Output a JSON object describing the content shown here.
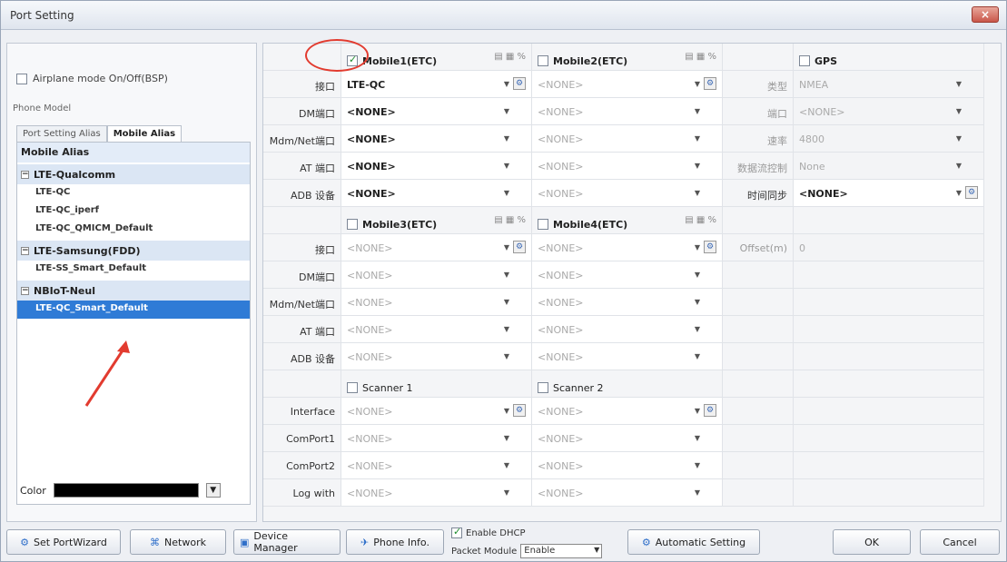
{
  "window": {
    "title": "Port Setting",
    "close_label": "×"
  },
  "left": {
    "airplane_label": "Airplane mode On/Off(BSP)",
    "group_label": "Phone Model",
    "tabs": [
      "Port Setting Alias",
      "Mobile Alias"
    ],
    "list_header": "Mobile Alias",
    "groups": [
      {
        "name": "LTE-Qualcomm",
        "items": [
          "LTE-QC",
          "LTE-QC_iperf",
          "LTE-QC_QMICM_Default"
        ]
      },
      {
        "name": "LTE-Samsung(FDD)",
        "items": [
          "LTE-SS_Smart_Default"
        ]
      },
      {
        "name": "NBIoT-Neul",
        "items": [
          "LTE-QC_Smart_Default"
        ]
      }
    ],
    "color_label": "Color"
  },
  "grid": {
    "mobile1": {
      "name": "Mobile1(ETC)",
      "checked": true
    },
    "mobile2": {
      "name": "Mobile2(ETC)",
      "checked": false
    },
    "mobile3": {
      "name": "Mobile3(ETC)",
      "checked": false
    },
    "mobile4": {
      "name": "Mobile4(ETC)",
      "checked": false
    },
    "gps": {
      "name": "GPS",
      "checked": false
    },
    "scanner1": "Scanner 1",
    "scanner2": "Scanner 2",
    "port_labels": [
      "接口",
      "DM端口",
      "Mdm/Net端口",
      "AT 端口",
      "ADB 设备"
    ],
    "scanner_labels": [
      "Interface",
      "ComPort1",
      "ComPort2",
      "Log with"
    ],
    "m1_values": [
      "LTE-QC",
      "<NONE>",
      "<NONE>",
      "<NONE>",
      "<NONE>"
    ],
    "none": "<NONE>",
    "gps_labels": [
      "类型",
      "端口",
      "速率",
      "数据流控制"
    ],
    "gps_values": [
      "NMEA",
      "<NONE>",
      "4800",
      "None"
    ],
    "time_sync_label": "时间同步",
    "time_sync_value": "<NONE>",
    "offset_label": "Offset(m)",
    "offset_value": "0"
  },
  "bottom": {
    "set_port_wizard": "Set PortWizard",
    "network": "Network",
    "device_manager": "Device Manager",
    "phone_info": "Phone Info.",
    "enable_dhcp": "Enable DHCP",
    "packet_module": "Packet Module",
    "packet_value": "Enable",
    "automatic_setting": "Automatic Setting",
    "ok": "OK",
    "cancel": "Cancel"
  },
  "colors": {
    "accent": "#2f7bd6",
    "annotation": "#e23b2f"
  }
}
